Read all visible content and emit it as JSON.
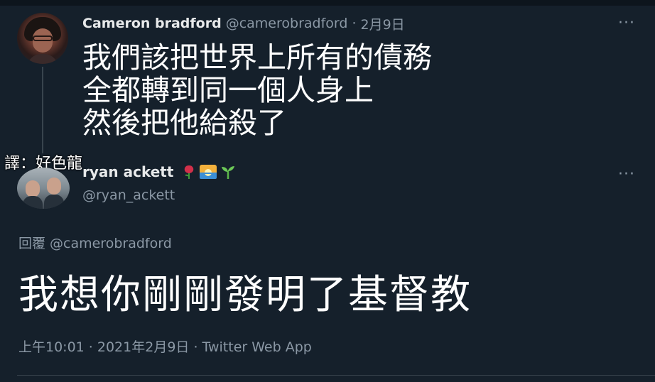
{
  "tweet1": {
    "name": "Cameron bradford",
    "handle": "@camerobradford",
    "separator": "·",
    "date": "2月9日",
    "more": "···",
    "text_lines": [
      "我們該把世界上所有的債務",
      "全都轉到同一個人身上",
      "然後把他給殺了"
    ]
  },
  "caption": "譯：好色龍",
  "tweet2": {
    "name": "ryan ackett",
    "emoji_icons": [
      "rose-icon",
      "sunrise-icon",
      "seedling-icon"
    ],
    "handle": "@ryan_ackett",
    "more": "···",
    "reply_label": "回覆",
    "reply_mention": "@camerobradford",
    "text": "我想你剛剛發明了基督教",
    "meta": "上午10:01 · 2021年2月9日 · Twitter Web App"
  },
  "colors": {
    "background": "#15202b",
    "text": "#ffffff",
    "muted": "#8b98a5",
    "divider": "#38444d"
  }
}
